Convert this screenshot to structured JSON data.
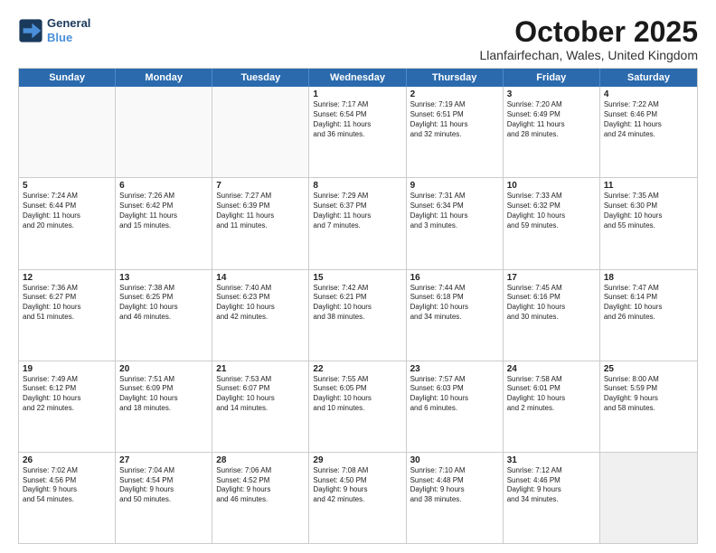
{
  "logo": {
    "line1": "General",
    "line2": "Blue"
  },
  "header": {
    "month": "October 2025",
    "location": "Llanfairfechan, Wales, United Kingdom"
  },
  "weekdays": [
    "Sunday",
    "Monday",
    "Tuesday",
    "Wednesday",
    "Thursday",
    "Friday",
    "Saturday"
  ],
  "rows": [
    [
      {
        "day": "",
        "text": "",
        "empty": true
      },
      {
        "day": "",
        "text": "",
        "empty": true
      },
      {
        "day": "",
        "text": "",
        "empty": true
      },
      {
        "day": "1",
        "text": "Sunrise: 7:17 AM\nSunset: 6:54 PM\nDaylight: 11 hours\nand 36 minutes."
      },
      {
        "day": "2",
        "text": "Sunrise: 7:19 AM\nSunset: 6:51 PM\nDaylight: 11 hours\nand 32 minutes."
      },
      {
        "day": "3",
        "text": "Sunrise: 7:20 AM\nSunset: 6:49 PM\nDaylight: 11 hours\nand 28 minutes."
      },
      {
        "day": "4",
        "text": "Sunrise: 7:22 AM\nSunset: 6:46 PM\nDaylight: 11 hours\nand 24 minutes."
      }
    ],
    [
      {
        "day": "5",
        "text": "Sunrise: 7:24 AM\nSunset: 6:44 PM\nDaylight: 11 hours\nand 20 minutes."
      },
      {
        "day": "6",
        "text": "Sunrise: 7:26 AM\nSunset: 6:42 PM\nDaylight: 11 hours\nand 15 minutes."
      },
      {
        "day": "7",
        "text": "Sunrise: 7:27 AM\nSunset: 6:39 PM\nDaylight: 11 hours\nand 11 minutes."
      },
      {
        "day": "8",
        "text": "Sunrise: 7:29 AM\nSunset: 6:37 PM\nDaylight: 11 hours\nand 7 minutes."
      },
      {
        "day": "9",
        "text": "Sunrise: 7:31 AM\nSunset: 6:34 PM\nDaylight: 11 hours\nand 3 minutes."
      },
      {
        "day": "10",
        "text": "Sunrise: 7:33 AM\nSunset: 6:32 PM\nDaylight: 10 hours\nand 59 minutes."
      },
      {
        "day": "11",
        "text": "Sunrise: 7:35 AM\nSunset: 6:30 PM\nDaylight: 10 hours\nand 55 minutes."
      }
    ],
    [
      {
        "day": "12",
        "text": "Sunrise: 7:36 AM\nSunset: 6:27 PM\nDaylight: 10 hours\nand 51 minutes."
      },
      {
        "day": "13",
        "text": "Sunrise: 7:38 AM\nSunset: 6:25 PM\nDaylight: 10 hours\nand 46 minutes."
      },
      {
        "day": "14",
        "text": "Sunrise: 7:40 AM\nSunset: 6:23 PM\nDaylight: 10 hours\nand 42 minutes."
      },
      {
        "day": "15",
        "text": "Sunrise: 7:42 AM\nSunset: 6:21 PM\nDaylight: 10 hours\nand 38 minutes."
      },
      {
        "day": "16",
        "text": "Sunrise: 7:44 AM\nSunset: 6:18 PM\nDaylight: 10 hours\nand 34 minutes."
      },
      {
        "day": "17",
        "text": "Sunrise: 7:45 AM\nSunset: 6:16 PM\nDaylight: 10 hours\nand 30 minutes."
      },
      {
        "day": "18",
        "text": "Sunrise: 7:47 AM\nSunset: 6:14 PM\nDaylight: 10 hours\nand 26 minutes."
      }
    ],
    [
      {
        "day": "19",
        "text": "Sunrise: 7:49 AM\nSunset: 6:12 PM\nDaylight: 10 hours\nand 22 minutes."
      },
      {
        "day": "20",
        "text": "Sunrise: 7:51 AM\nSunset: 6:09 PM\nDaylight: 10 hours\nand 18 minutes."
      },
      {
        "day": "21",
        "text": "Sunrise: 7:53 AM\nSunset: 6:07 PM\nDaylight: 10 hours\nand 14 minutes."
      },
      {
        "day": "22",
        "text": "Sunrise: 7:55 AM\nSunset: 6:05 PM\nDaylight: 10 hours\nand 10 minutes."
      },
      {
        "day": "23",
        "text": "Sunrise: 7:57 AM\nSunset: 6:03 PM\nDaylight: 10 hours\nand 6 minutes."
      },
      {
        "day": "24",
        "text": "Sunrise: 7:58 AM\nSunset: 6:01 PM\nDaylight: 10 hours\nand 2 minutes."
      },
      {
        "day": "25",
        "text": "Sunrise: 8:00 AM\nSunset: 5:59 PM\nDaylight: 9 hours\nand 58 minutes."
      }
    ],
    [
      {
        "day": "26",
        "text": "Sunrise: 7:02 AM\nSunset: 4:56 PM\nDaylight: 9 hours\nand 54 minutes."
      },
      {
        "day": "27",
        "text": "Sunrise: 7:04 AM\nSunset: 4:54 PM\nDaylight: 9 hours\nand 50 minutes."
      },
      {
        "day": "28",
        "text": "Sunrise: 7:06 AM\nSunset: 4:52 PM\nDaylight: 9 hours\nand 46 minutes."
      },
      {
        "day": "29",
        "text": "Sunrise: 7:08 AM\nSunset: 4:50 PM\nDaylight: 9 hours\nand 42 minutes."
      },
      {
        "day": "30",
        "text": "Sunrise: 7:10 AM\nSunset: 4:48 PM\nDaylight: 9 hours\nand 38 minutes."
      },
      {
        "day": "31",
        "text": "Sunrise: 7:12 AM\nSunset: 4:46 PM\nDaylight: 9 hours\nand 34 minutes."
      },
      {
        "day": "",
        "text": "",
        "empty": true,
        "shaded": true
      }
    ]
  ]
}
